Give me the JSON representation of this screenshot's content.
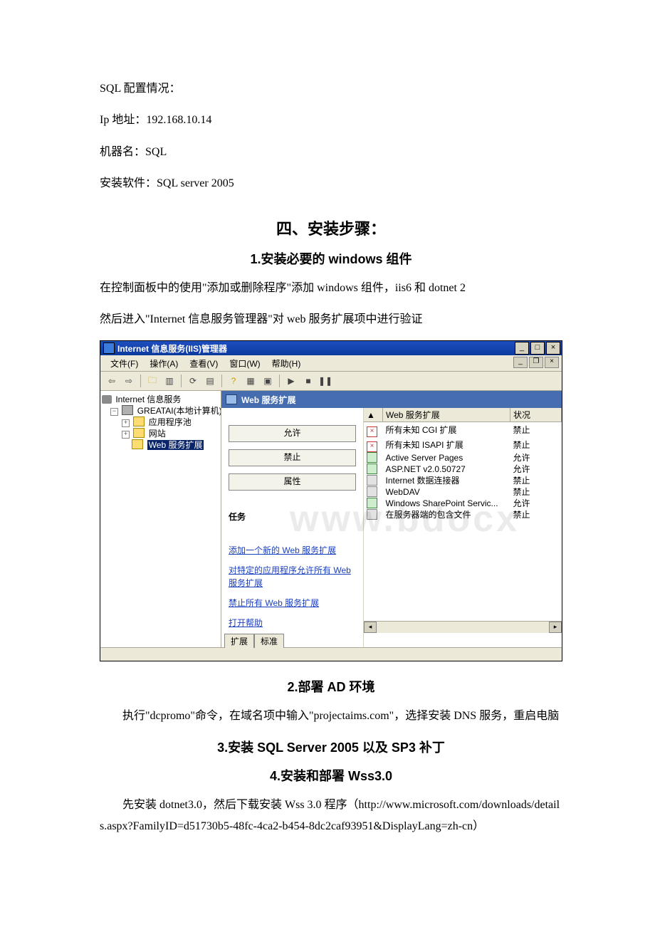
{
  "paragraphs": {
    "sql_config": "SQL 配置情况：",
    "ip": "Ip 地址：192.168.10.14",
    "machine_name": "机器名：SQL",
    "installed": "安装软件：SQL server 2005"
  },
  "headings": {
    "section4": "四、安装步骤：",
    "step1": "1.安装必要的 windows 组件",
    "step2": "2.部署 AD 环境",
    "step3": "3.安装 SQL Server 2005 以及 SP3 补丁",
    "step4": "4.安装和部署 Wss3.0"
  },
  "body": {
    "step1_p1": "在控制面板中的使用\"添加或删除程序\"添加 windows 组件，iis6 和 dotnet 2",
    "step1_p2": "然后进入\"Internet 信息服务管理器\"对 web 服务扩展项中进行验证",
    "step2_p1": "执行\"dcpromo\"命令，在域名项中输入\"projectaims.com\"，选择安装 DNS 服务，重启电脑",
    "step4_p1": "先安装 dotnet3.0，然后下载安装 Wss 3.0 程序（http://www.microsoft.com/downloads/details.aspx?FamilyID=d51730b5-48fc-4ca2-b454-8dc2caf93951&DisplayLang=zh-cn）"
  },
  "iis": {
    "title": "Internet 信息服务(IIS)管理器",
    "menus": {
      "file": "文件(F)",
      "action": "操作(A)",
      "view": "查看(V)",
      "window": "窗口(W)",
      "help": "帮助(H)"
    },
    "tree": {
      "root": "Internet 信息服务",
      "computer": "GREATAI(本地计算机)",
      "app_pool": "应用程序池",
      "sites": "网站",
      "web_ext": "Web 服务扩展"
    },
    "content_title": "Web 服务扩展",
    "task_buttons": {
      "allow": "允许",
      "deny": "禁止",
      "props": "属性"
    },
    "task_heading": "任务",
    "task_links": {
      "add": "添加一个新的 Web 服务扩展",
      "allow_app": "对特定的应用程序允许所有 Web 服务扩展",
      "deny_all": "禁止所有 Web 服务扩展",
      "help": "打开帮助"
    },
    "ext_table": {
      "col_name": "Web 服务扩展",
      "col_status": "状况",
      "rows": [
        {
          "name": "所有未知 CGI 扩展",
          "status": "禁止",
          "icon": "redx"
        },
        {
          "name": "所有未知 ISAPI 扩展",
          "status": "禁止",
          "icon": "redx"
        },
        {
          "name": "Active Server Pages",
          "status": "允许",
          "icon": "green"
        },
        {
          "name": "ASP.NET v2.0.50727",
          "status": "允许",
          "icon": "green"
        },
        {
          "name": "Internet 数据连接器",
          "status": "禁止",
          "icon": "plain"
        },
        {
          "name": "WebDAV",
          "status": "禁止",
          "icon": "plain"
        },
        {
          "name": "Windows SharePoint Servic...",
          "status": "允许",
          "icon": "green"
        },
        {
          "name": "在服务器端的包含文件",
          "status": "禁止",
          "icon": "plain"
        }
      ]
    },
    "tabs": {
      "extended": "扩展",
      "standard": "标准"
    },
    "watermark": "www.bdocx"
  }
}
